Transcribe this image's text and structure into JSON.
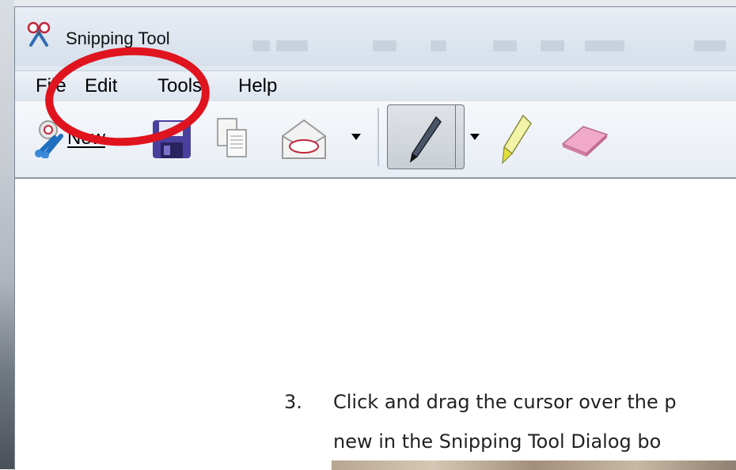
{
  "window": {
    "title": "Snipping Tool"
  },
  "menu": {
    "items": [
      {
        "label": "File"
      },
      {
        "label": "Edit"
      },
      {
        "label": "Tools"
      },
      {
        "label": "Help"
      }
    ]
  },
  "toolbar": {
    "new_label": "New",
    "icons": [
      "scissors-icon",
      "save-icon",
      "copy-icon",
      "send-snip-icon",
      "dropdown-arrow-icon",
      "pen-icon",
      "highlighter-icon",
      "eraser-icon"
    ]
  },
  "document": {
    "step_number": "3.",
    "line1": "Click and drag the cursor over the p",
    "line2": "new in the Snipping Tool Dialog bo"
  },
  "annotation": {
    "circle_color": "#e0141e"
  }
}
